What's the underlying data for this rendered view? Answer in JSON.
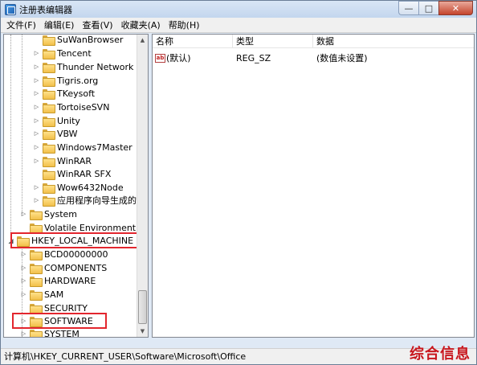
{
  "window": {
    "title": "注册表编辑器",
    "controls": {
      "minimize": "—",
      "maximize": "□",
      "close": "✕"
    }
  },
  "menu": [
    "文件(F)",
    "编辑(E)",
    "查看(V)",
    "收藏夹(A)",
    "帮助(H)"
  ],
  "tree": {
    "items": [
      {
        "label": "SuWanBrowser"
      },
      {
        "label": "Tencent"
      },
      {
        "label": "Thunder Network"
      },
      {
        "label": "Tigris.org"
      },
      {
        "label": "TKeysoft"
      },
      {
        "label": "TortoiseSVN"
      },
      {
        "label": "Unity"
      },
      {
        "label": "VBW"
      },
      {
        "label": "Windows7Master"
      },
      {
        "label": "WinRAR"
      },
      {
        "label": "WinRAR SFX"
      },
      {
        "label": "Wow6432Node"
      },
      {
        "label": "应用程序向导生成的本"
      },
      {
        "label": "System"
      },
      {
        "label": "Volatile Environment"
      },
      {
        "label": "HKEY_LOCAL_MACHINE"
      },
      {
        "label": "BCD00000000"
      },
      {
        "label": "COMPONENTS"
      },
      {
        "label": "HARDWARE"
      },
      {
        "label": "SAM"
      },
      {
        "label": "SECURITY"
      },
      {
        "label": "SOFTWARE"
      },
      {
        "label": "SYSTEM"
      }
    ]
  },
  "list": {
    "columns": [
      "名称",
      "类型",
      "数据"
    ],
    "rows": [
      {
        "icon": "ab",
        "name": "(默认)",
        "type": "REG_SZ",
        "data": "(数值未设置)"
      }
    ]
  },
  "status": {
    "path": "计算机\\HKEY_CURRENT_USER\\Software\\Microsoft\\Office"
  },
  "watermark": "综合信息",
  "colors": {
    "highlight": "#e3262e",
    "watermark": "#c8161d"
  }
}
